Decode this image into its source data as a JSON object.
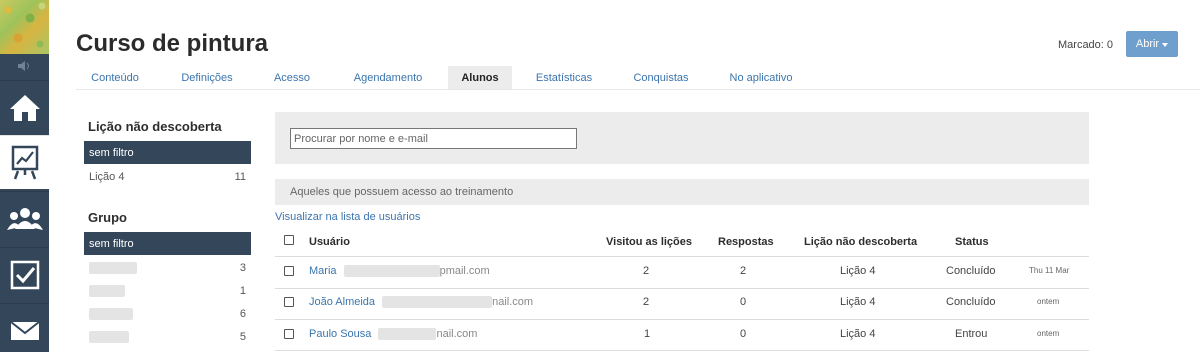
{
  "nav": {
    "items": [
      {
        "name": "home",
        "icon": "home-icon"
      },
      {
        "name": "stats",
        "icon": "chart-easel-icon"
      },
      {
        "name": "users",
        "icon": "users-icon"
      },
      {
        "name": "tasks",
        "icon": "checkbox-icon"
      },
      {
        "name": "messages",
        "icon": "envelope-icon"
      }
    ],
    "accent": "#34475a"
  },
  "header": {
    "title": "Curso de pintura",
    "marked_label": "Marcado: 0",
    "open_button": "Abrir"
  },
  "tabs": [
    "Conteúdo",
    "Definições",
    "Acesso",
    "Agendamento",
    "Alunos",
    "Estatísticas",
    "Conquistas",
    "No aplicativo"
  ],
  "active_tab": "Alunos",
  "filters": {
    "lesson": {
      "title": "Lição não descoberta",
      "selected": "sem filtro",
      "options": [
        {
          "label": "Lição 4",
          "count": "11"
        }
      ]
    },
    "group": {
      "title": "Grupo",
      "selected": "sem filtro",
      "options": [
        {
          "count": "3"
        },
        {
          "count": "1"
        },
        {
          "count": "6"
        },
        {
          "count": "5"
        }
      ]
    }
  },
  "search": {
    "placeholder": "Procurar por nome e e-mail"
  },
  "access_bar": "Aqueles que possuem acesso ao treinamento",
  "view_link": "Visualizar na lista de usuários",
  "table": {
    "columns": [
      "Usuário",
      "Visitou as lições",
      "Respostas",
      "Lição não descoberta",
      "Status"
    ],
    "rows": [
      {
        "name": "Maria",
        "email_tail": "pmail.com",
        "visited": "2",
        "answers": "2",
        "lesson": "Lição 4",
        "status": "Concluído",
        "date": "Thu 11 Mar"
      },
      {
        "name": "João Almeida",
        "email_tail": "nail.com",
        "visited": "2",
        "answers": "0",
        "lesson": "Lição 4",
        "status": "Concluído",
        "date": "ontem"
      },
      {
        "name": "Paulo Sousa",
        "email_tail": "nail.com",
        "visited": "1",
        "answers": "0",
        "lesson": "Lição 4",
        "status": "Entrou",
        "date": "ontem"
      }
    ]
  },
  "colors": {
    "link": "#3b75ae",
    "button": "#6fa0cd",
    "panel": "#ececec"
  }
}
